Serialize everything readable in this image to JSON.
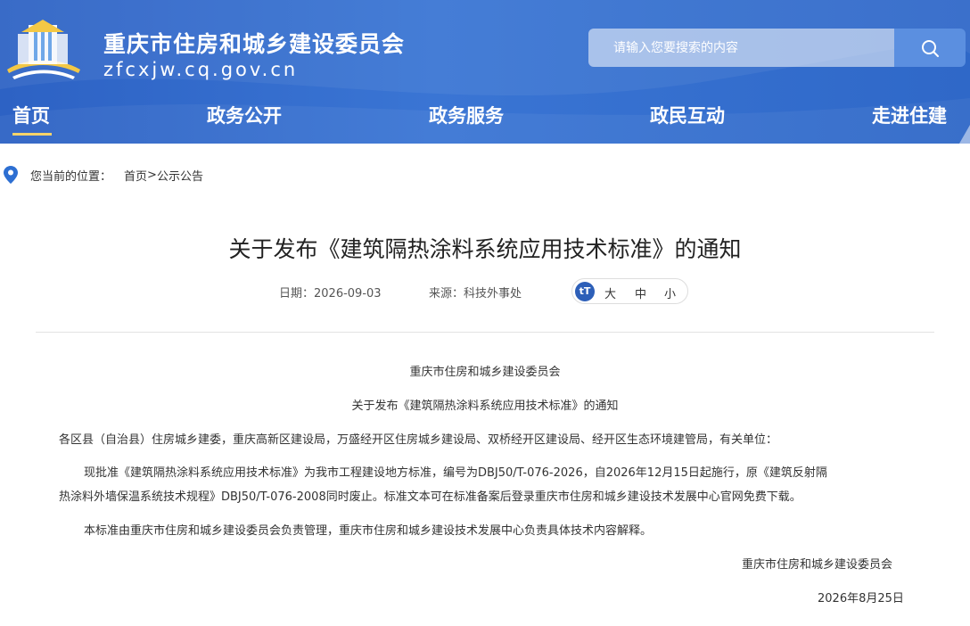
{
  "header": {
    "site_title": "重庆市住房和城乡建设委员会",
    "site_domain": "zfcxjw.cq.gov.cn",
    "search_placeholder": "请输入您要搜索的内容"
  },
  "nav": {
    "items": [
      {
        "label": "首页",
        "active": true
      },
      {
        "label": "政务公开"
      },
      {
        "label": "政务服务"
      },
      {
        "label": "政民互动"
      },
      {
        "label": "走进住建"
      }
    ]
  },
  "breadcrumb": {
    "label": "您当前的位置：",
    "home": "首页",
    "separator": ">",
    "current": "公示公告"
  },
  "article": {
    "title": "关于发布《建筑隔热涂料系统应用技术标准》的通知",
    "date": "日期：2026-09-03",
    "source": "来源：科技外事处",
    "font_large": "大",
    "font_medium": "中",
    "font_small": "小",
    "font_icon_text": "tT",
    "body": {
      "issuer": "重庆市住房和城乡建设委员会",
      "subject": "关于发布《建筑隔热涂料系统应用技术标准》的通知",
      "recipients": "各区县（自治县）住房城乡建委，重庆高新区建设局，万盛经开区住房城乡建设局、双桥经开区建设局、经开区生态环境建管局，有关单位：",
      "para1_line1": "现批准《建筑隔热涂料系统应用技术标准》为我市工程建设地方标准，编号为DBJ50/T-076-2026，自2026年12月15日起施行，原《建筑反射隔",
      "para1_line2": "热涂料外墙保温系统技术规程》DBJ50/T-076-2008同时废止。标准文本可在标准备案后登录重庆市住房和城乡建设技术发展中心官网免费下载。",
      "para2": "本标准由重庆市住房和城乡建设委员会负责管理，重庆市住房和城乡建设技术发展中心负责具体技术内容解释。",
      "signature": "重庆市住房和城乡建设委员会",
      "sign_date": "2026年8月25日"
    }
  },
  "colors": {
    "header_bg": "#3a75d4",
    "nav_active_underline": "#f5d36a",
    "font_tool_icon": "#2d5fb8"
  }
}
